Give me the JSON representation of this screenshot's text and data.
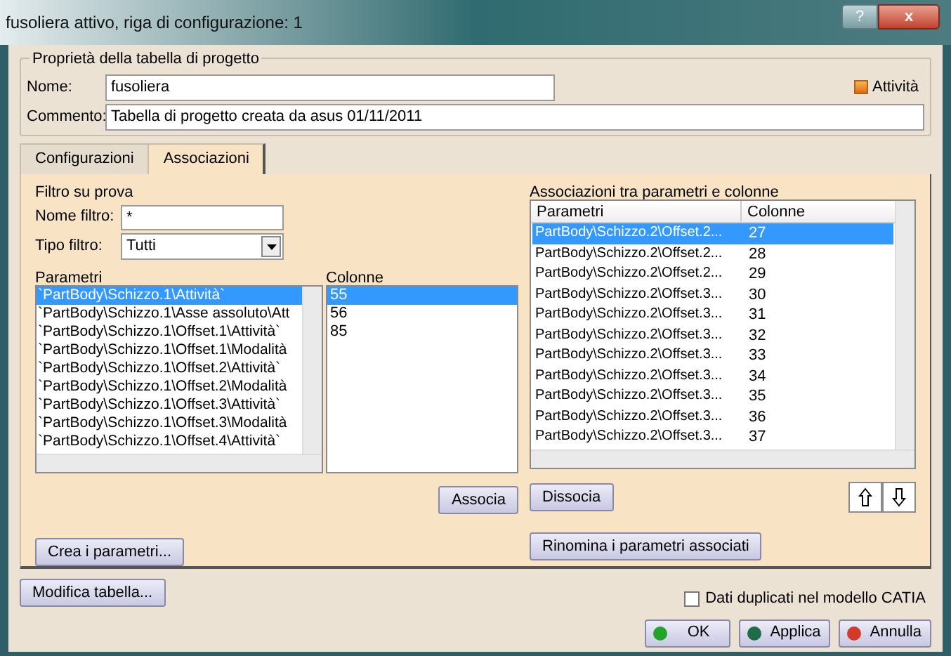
{
  "window": {
    "title": "fusoliera attivo, riga di configurazione: 1",
    "help": "?",
    "close": "x"
  },
  "properties": {
    "title": "Proprietà della tabella di progetto",
    "name_label": "Nome:",
    "name_value": "fusoliera",
    "comment_label": "Commento:",
    "comment_value": "Tabella di progetto creata da asus 01/11/2011",
    "active": {
      "label": "Attività",
      "checked": true
    }
  },
  "tabs": [
    {
      "label": "Configurazioni",
      "selected": false
    },
    {
      "label": "Associazioni",
      "selected": true
    }
  ],
  "filter": {
    "title": "Filtro su prova",
    "name_label": "Nome filtro:",
    "name_value": "*",
    "type_label": "Tipo filtro:",
    "type_value": "Tutti"
  },
  "parameters": {
    "label": "Parametri",
    "items": [
      {
        "text": "`PartBody\\Schizzo.1\\Attività`",
        "selected": true
      },
      {
        "text": "`PartBody\\Schizzo.1\\Asse assoluto\\Att",
        "selected": false
      },
      {
        "text": "`PartBody\\Schizzo.1\\Offset.1\\Attività`",
        "selected": false
      },
      {
        "text": "`PartBody\\Schizzo.1\\Offset.1\\Modalità",
        "selected": false
      },
      {
        "text": "`PartBody\\Schizzo.1\\Offset.2\\Attività`",
        "selected": false
      },
      {
        "text": "`PartBody\\Schizzo.1\\Offset.2\\Modalità",
        "selected": false
      },
      {
        "text": "`PartBody\\Schizzo.1\\Offset.3\\Attività`",
        "selected": false
      },
      {
        "text": "`PartBody\\Schizzo.1\\Offset.3\\Modalità",
        "selected": false
      },
      {
        "text": "`PartBody\\Schizzo.1\\Offset.4\\Attività`",
        "selected": false
      }
    ]
  },
  "columns": {
    "label": "Colonne",
    "items": [
      {
        "text": "55",
        "selected": true
      },
      {
        "text": "56",
        "selected": false
      },
      {
        "text": "85",
        "selected": false
      }
    ]
  },
  "associations": {
    "title": "Associazioni tra parametri e colonne",
    "headers": [
      "Parametri",
      "Colonne"
    ],
    "rows": [
      {
        "parameter": "PartBody\\Schizzo.2\\Offset.2...",
        "column": "27",
        "selected": true
      },
      {
        "parameter": "PartBody\\Schizzo.2\\Offset.2...",
        "column": "28",
        "selected": false
      },
      {
        "parameter": "PartBody\\Schizzo.2\\Offset.2...",
        "column": "29",
        "selected": false
      },
      {
        "parameter": "PartBody\\Schizzo.2\\Offset.3...",
        "column": "30",
        "selected": false
      },
      {
        "parameter": "PartBody\\Schizzo.2\\Offset.3...",
        "column": "31",
        "selected": false
      },
      {
        "parameter": "PartBody\\Schizzo.2\\Offset.3...",
        "column": "32",
        "selected": false
      },
      {
        "parameter": "PartBody\\Schizzo.2\\Offset.3...",
        "column": "33",
        "selected": false
      },
      {
        "parameter": "PartBody\\Schizzo.2\\Offset.3...",
        "column": "34",
        "selected": false
      },
      {
        "parameter": "PartBody\\Schizzo.2\\Offset.3...",
        "column": "35",
        "selected": false
      },
      {
        "parameter": "PartBody\\Schizzo.2\\Offset.3...",
        "column": "36",
        "selected": false
      },
      {
        "parameter": "PartBody\\Schizzo.2\\Offset.3...",
        "column": "37",
        "selected": false
      }
    ]
  },
  "buttons": {
    "associate": "Associa",
    "dissociate": "Dissocia",
    "create": "Crea i parametri...",
    "rename": "Rinomina i parametri associati",
    "modify": "Modifica tabella..."
  },
  "duplicate": {
    "label": "Dati duplicati nel modello CATIA",
    "checked": false
  },
  "dialog_buttons": [
    {
      "label": "OK",
      "color": "#22a32a"
    },
    {
      "label": "Applica",
      "color": "#1f6b4a"
    },
    {
      "label": "Annulla",
      "color": "#d23a2a"
    }
  ]
}
